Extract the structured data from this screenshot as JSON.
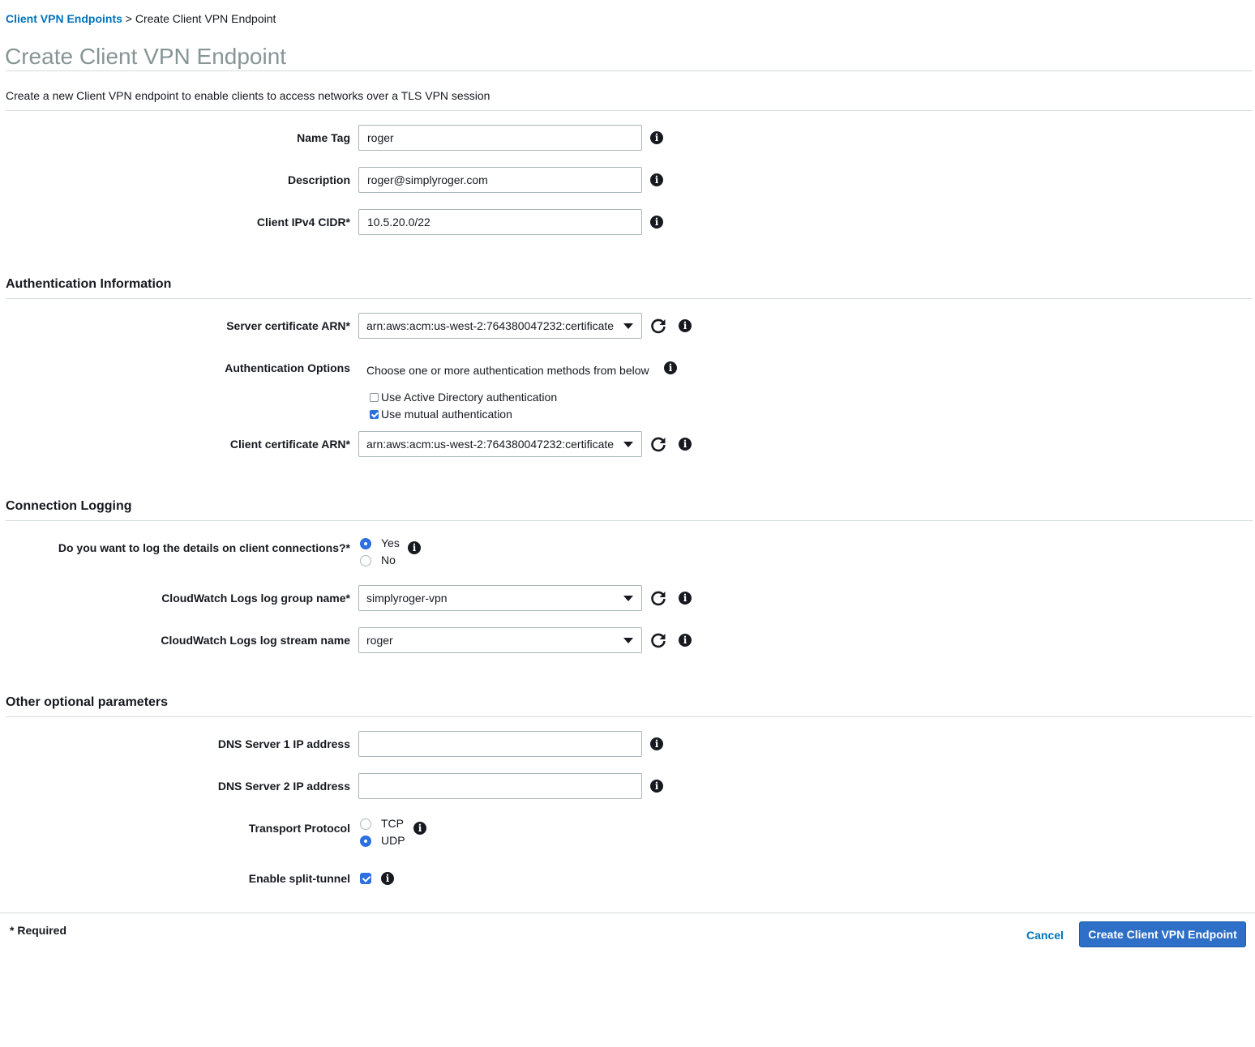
{
  "breadcrumb": {
    "parent": "Client VPN Endpoints",
    "separator": ">",
    "current": "Create Client VPN Endpoint"
  },
  "page": {
    "title": "Create Client VPN Endpoint",
    "intro": "Create a new Client VPN endpoint to enable clients to access networks over a TLS VPN session"
  },
  "general": {
    "name_tag": {
      "label": "Name Tag",
      "value": "roger"
    },
    "description": {
      "label": "Description",
      "value": "roger@simplyroger.com"
    },
    "client_cidr": {
      "label": "Client IPv4 CIDR*",
      "value": "10.5.20.0/22"
    }
  },
  "auth": {
    "section_title": "Authentication Information",
    "server_cert": {
      "label": "Server certificate ARN*",
      "value": "arn:aws:acm:us-west-2:764380047232:certificate"
    },
    "options": {
      "label": "Authentication Options",
      "helper": "Choose one or more authentication methods from below",
      "active_directory": {
        "label": "Use Active Directory authentication",
        "checked": false
      },
      "mutual": {
        "label": "Use mutual authentication",
        "checked": true
      }
    },
    "client_cert": {
      "label": "Client certificate ARN*",
      "value": "arn:aws:acm:us-west-2:764380047232:certificate"
    }
  },
  "logging": {
    "section_title": "Connection Logging",
    "question": {
      "label": "Do you want to log the details on client connections?*",
      "yes": "Yes",
      "no": "No",
      "selected": "Yes"
    },
    "log_group": {
      "label": "CloudWatch Logs log group name*",
      "value": "simplyroger-vpn"
    },
    "log_stream": {
      "label": "CloudWatch Logs log stream name",
      "value": "roger"
    }
  },
  "optional": {
    "section_title": "Other optional parameters",
    "dns1": {
      "label": "DNS Server 1 IP address",
      "value": ""
    },
    "dns2": {
      "label": "DNS Server 2 IP address",
      "value": ""
    },
    "transport": {
      "label": "Transport Protocol",
      "tcp": "TCP",
      "udp": "UDP",
      "selected": "UDP"
    },
    "split_tunnel": {
      "label": "Enable split-tunnel",
      "checked": true
    }
  },
  "footer": {
    "required_note": "* Required",
    "cancel_label": "Cancel",
    "submit_label": "Create Client VPN Endpoint"
  },
  "icons": {
    "info": "info-icon",
    "refresh": "refresh-icon",
    "dropdown": "chevron-down-icon"
  },
  "colors": {
    "link": "#0073bb",
    "primary_button": "#2e6fc7",
    "checked": "#2c6fe0",
    "title_gray": "#879596"
  }
}
